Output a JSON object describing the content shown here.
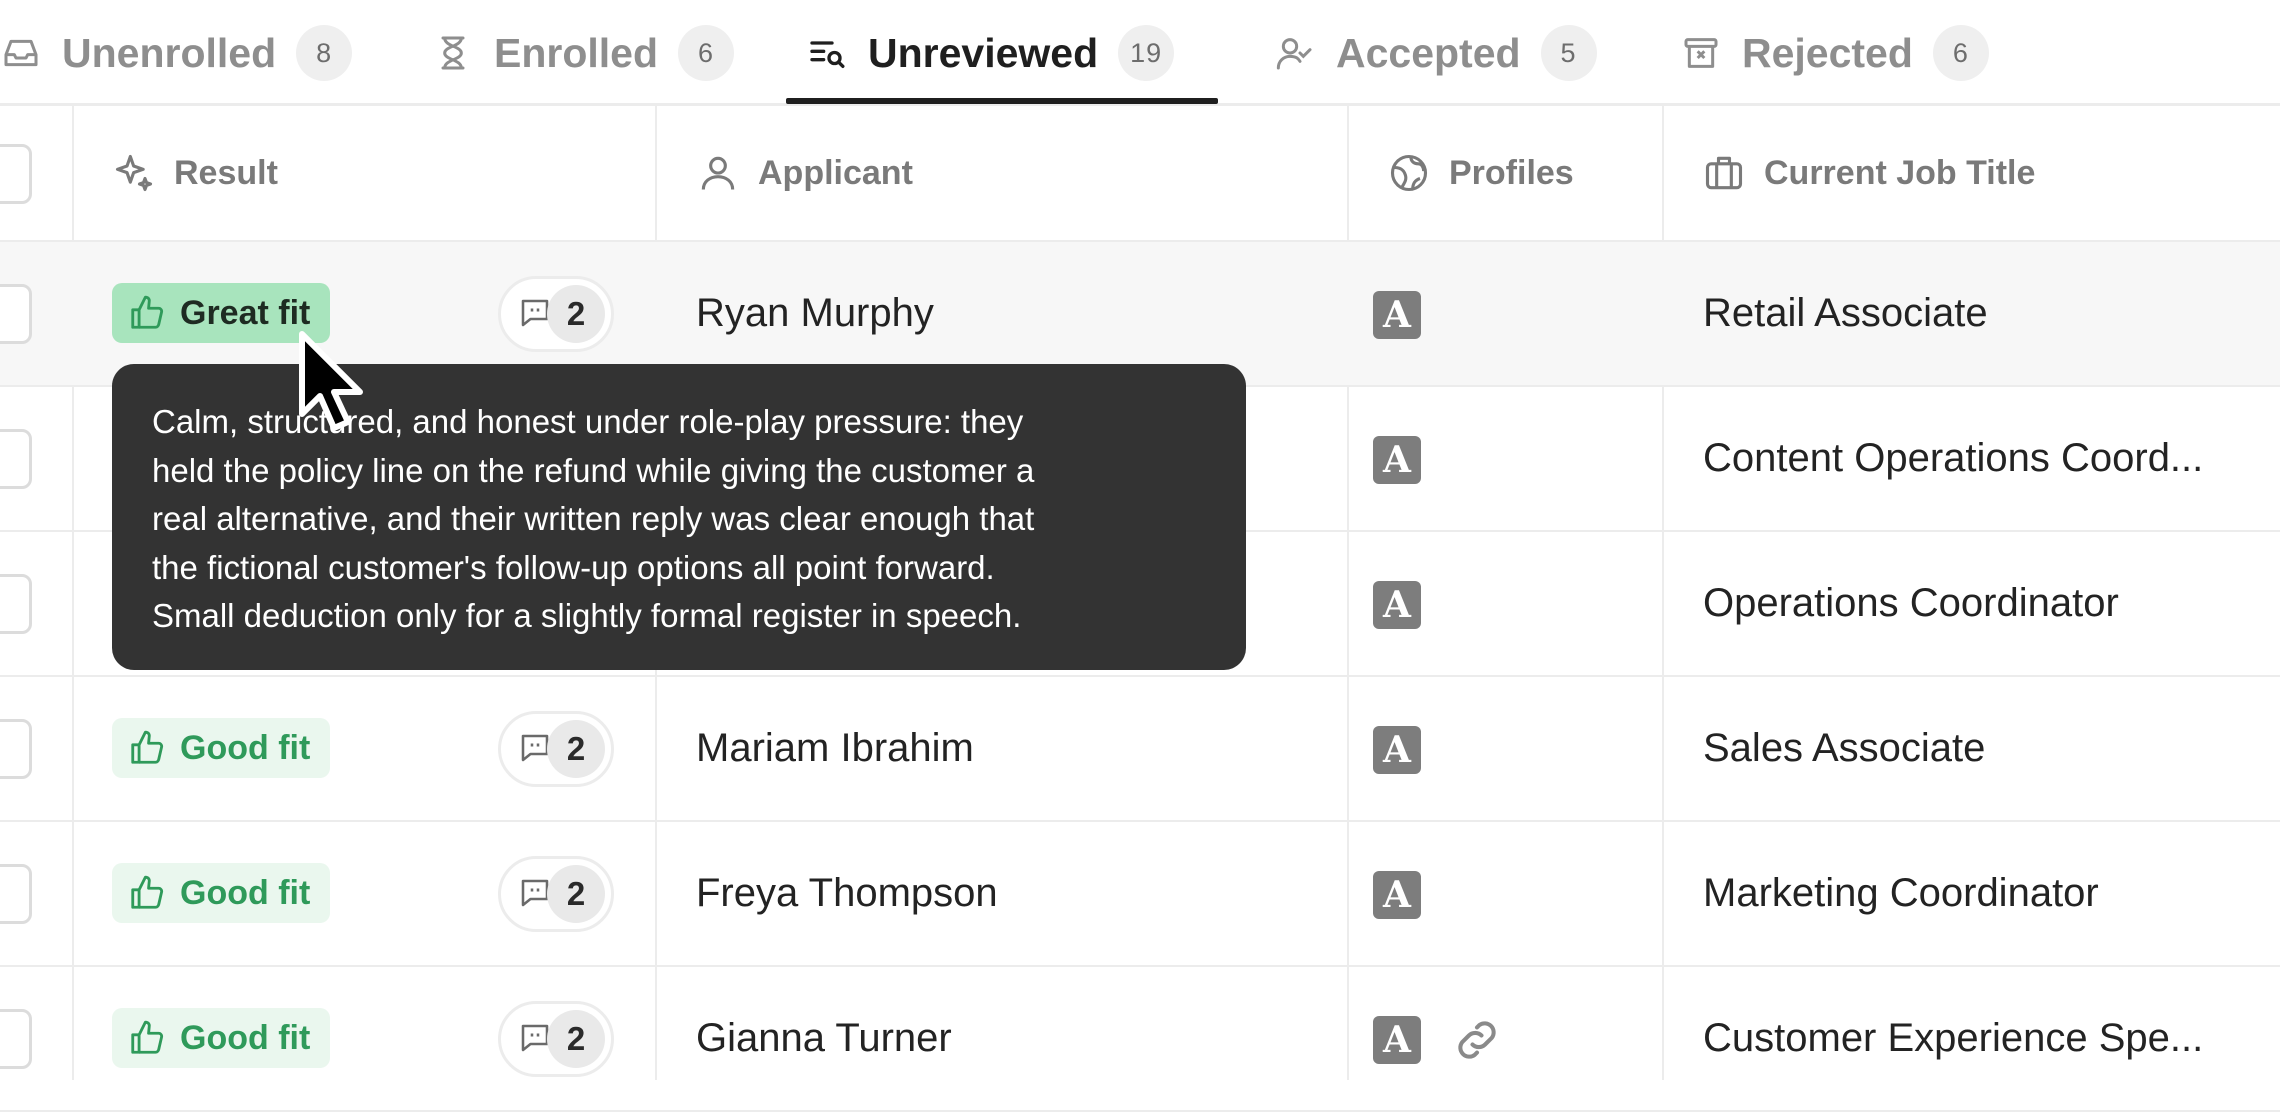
{
  "tabs": [
    {
      "label": "Unenrolled",
      "count": "8",
      "icon": "inbox-icon"
    },
    {
      "label": "Enrolled",
      "count": "6",
      "icon": "hourglass-icon"
    },
    {
      "label": "Unreviewed",
      "count": "19",
      "icon": "list-search-icon",
      "active": true
    },
    {
      "label": "Accepted",
      "count": "5",
      "icon": "user-check-icon"
    },
    {
      "label": "Rejected",
      "count": "6",
      "icon": "archive-x-icon"
    }
  ],
  "columns": {
    "result": "Result",
    "applicant": "Applicant",
    "profiles": "Profiles",
    "job_title": "Current Job Title"
  },
  "rows": [
    {
      "result": "Great fit",
      "comments": "2",
      "applicant": "Ryan Murphy",
      "profiles": [
        "A"
      ],
      "job_title": "Retail Associate"
    },
    {
      "result": "",
      "comments": "",
      "applicant": "",
      "profiles": [
        "A"
      ],
      "job_title": "Content Operations Coord..."
    },
    {
      "result": "",
      "comments": "",
      "applicant": "",
      "profiles": [
        "A"
      ],
      "job_title": "Operations Coordinator"
    },
    {
      "result": "Good fit",
      "comments": "2",
      "applicant": "Mariam Ibrahim",
      "profiles": [
        "A"
      ],
      "job_title": "Sales Associate"
    },
    {
      "result": "Good fit",
      "comments": "2",
      "applicant": "Freya Thompson",
      "profiles": [
        "A"
      ],
      "job_title": "Marketing Coordinator"
    },
    {
      "result": "Good fit",
      "comments": "2",
      "applicant": "Gianna Turner",
      "profiles": [
        "A",
        "link"
      ],
      "job_title": "Customer Experience Spe..."
    }
  ],
  "tooltip": {
    "text": "Calm, structured, and honest under role-play pressure: they\nheld the policy line on the refund while giving the customer a\nreal alternative, and their written reply was clear enough that\nthe fictional customer's follow-up options all point forward.\nSmall deduction only for a slightly formal register in speech."
  },
  "colors": {
    "great_fit_bg": "#a8e4bd",
    "good_fit_bg": "#eaf7ee",
    "good_fit_text": "#2f9a5a",
    "tooltip_bg": "#333333",
    "active_tab": "#1f1f1f"
  }
}
